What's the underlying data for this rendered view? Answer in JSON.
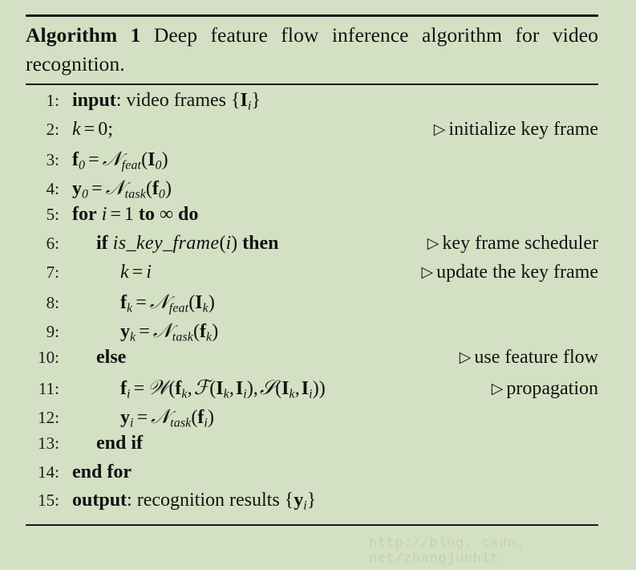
{
  "figure": {
    "title": {
      "label": "Algorithm",
      "number": "1",
      "description": "Deep feature flow inference algorithm for video recognition."
    },
    "comment_marker": "▷",
    "lines": [
      {
        "number": "1",
        "indent": 0,
        "code_text": "input: video frames {I_i}",
        "comment": ""
      },
      {
        "number": "2",
        "indent": 0,
        "code_text": "k = 0;",
        "comment": "initialize key frame"
      },
      {
        "number": "3",
        "indent": 0,
        "code_text": "f_0 = N_feat(I_0)",
        "comment": ""
      },
      {
        "number": "4",
        "indent": 0,
        "code_text": "y_0 = N_task(f_0)",
        "comment": ""
      },
      {
        "number": "5",
        "indent": 0,
        "code_text": "for i = 1 to ∞ do",
        "comment": ""
      },
      {
        "number": "6",
        "indent": 1,
        "code_text": "if is_key_frame(i) then",
        "comment": "key frame scheduler"
      },
      {
        "number": "7",
        "indent": 2,
        "code_text": "k = i",
        "comment": "update the key frame"
      },
      {
        "number": "8",
        "indent": 2,
        "code_text": "f_k = N_feat(I_k)",
        "comment": ""
      },
      {
        "number": "9",
        "indent": 2,
        "code_text": "y_k = N_task(f_k)",
        "comment": ""
      },
      {
        "number": "10",
        "indent": 1,
        "code_text": "else",
        "comment": "use feature flow"
      },
      {
        "number": "11",
        "indent": 2,
        "code_text": "f_i = W(f_k, F(I_k, I_i), S(I_k, I_i))",
        "comment": "propagation"
      },
      {
        "number": "12",
        "indent": 2,
        "code_text": "y_i = N_task(f_i)",
        "comment": ""
      },
      {
        "number": "13",
        "indent": 1,
        "code_text": "end if",
        "comment": ""
      },
      {
        "number": "14",
        "indent": 0,
        "code_text": "end for",
        "comment": ""
      },
      {
        "number": "15",
        "indent": 0,
        "code_text": "output: recognition results {y_i}",
        "comment": ""
      }
    ]
  },
  "watermark": {
    "text": "http://blog. csdn. net/zhangjunhit"
  },
  "colors": {
    "background": "#d4e0c4",
    "text": "#111111",
    "rule": "#1a1a1a",
    "watermark": "#c3d0ae"
  }
}
